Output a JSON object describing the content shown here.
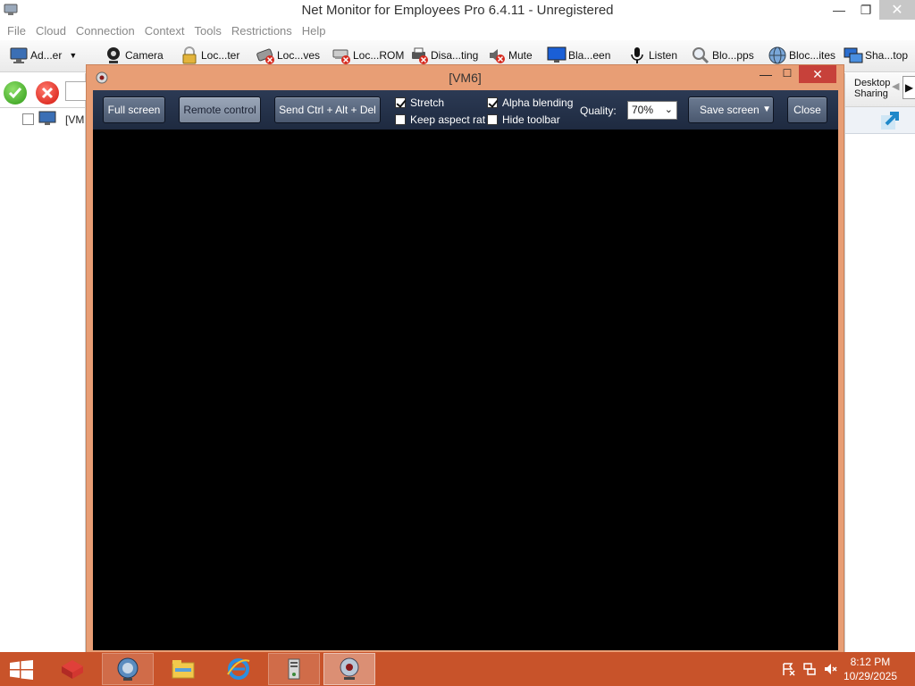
{
  "window": {
    "title": "Net Monitor for Employees Pro 6.4.11 - Unregistered",
    "min_glyph": "—",
    "max_glyph": "❐",
    "close_glyph": "✕"
  },
  "menu": [
    "File",
    "Cloud",
    "Connection",
    "Context",
    "Tools",
    "Restrictions",
    "Help"
  ],
  "toolbar": {
    "items": [
      "Ad...er",
      "Camera",
      "Loc...ter",
      "Loc...ves",
      "Loc...ROM",
      "Disa...ting",
      "Mute",
      "Bla...een",
      "Listen",
      "Blo...pps",
      "Bloc...ites",
      "Sha...top"
    ],
    "dropdown_glyph": "▼"
  },
  "tree": {
    "items": [
      {
        "label": "[VM"
      }
    ]
  },
  "right_panel": {
    "desktop_sharing_line1": "Desktop",
    "desktop_sharing_line2": "Sharing",
    "prev_glyph": "◀",
    "next_glyph": "▶"
  },
  "dialog": {
    "title": "[VM6]",
    "min_glyph": "—",
    "max_glyph": "☐",
    "close_glyph": "✕",
    "buttons": {
      "full_screen": "Full screen",
      "remote_control": "Remote control",
      "send_ctrl_alt_del": "Send Ctrl + Alt + Del",
      "save_screen": "Save screen",
      "close": "Close"
    },
    "checkboxes": {
      "stretch": {
        "label": "Stretch",
        "checked": true
      },
      "keep_aspect": {
        "label": "Keep aspect rat",
        "checked": false
      },
      "alpha_blending": {
        "label": "Alpha blending",
        "checked": true
      },
      "hide_toolbar": {
        "label": "Hide toolbar",
        "checked": false
      }
    },
    "quality_label": "Quality:",
    "quality_value": "70%",
    "select_chev": "⌄",
    "save_drop_glyph": "▼"
  },
  "taskbar": {
    "time": "8:12 PM",
    "date": "10/29/2025"
  },
  "colors": {
    "dialog_frame": "#e89e75",
    "viewer_toolbar": "#1e2a40",
    "taskbar": "#c8532a"
  }
}
